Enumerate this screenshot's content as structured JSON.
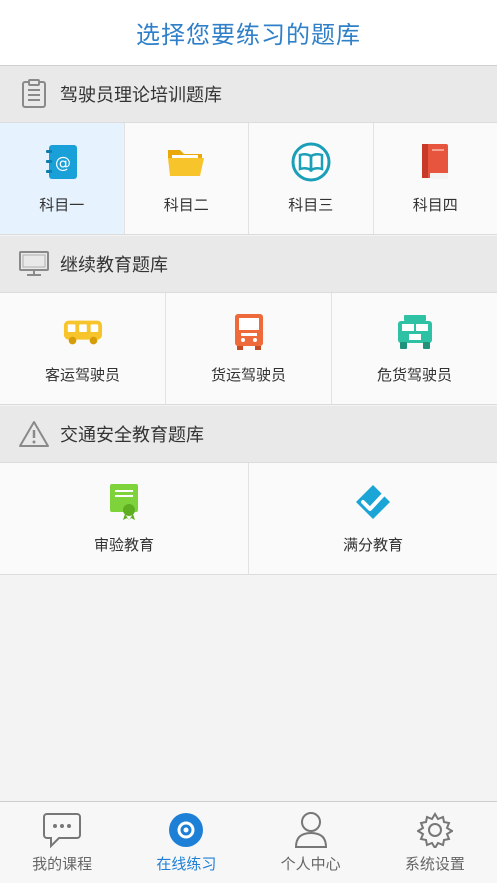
{
  "header": {
    "title": "选择您要练习的题库"
  },
  "colors": {
    "accent": "#1e7fd6",
    "title": "#2f80c8",
    "active_cell": "#e6f2fd"
  },
  "sections": [
    {
      "title": "驾驶员理论培训题库",
      "icon": "clipboard-icon",
      "items": [
        {
          "label": "科目一",
          "icon": "address-book-icon",
          "active": true
        },
        {
          "label": "科目二",
          "icon": "folder-icon"
        },
        {
          "label": "科目三",
          "icon": "book-icon"
        },
        {
          "label": "科目四",
          "icon": "red-book-icon"
        }
      ]
    },
    {
      "title": "继续教育题库",
      "icon": "monitor-icon",
      "items": [
        {
          "label": "客运驾驶员",
          "icon": "bus-icon"
        },
        {
          "label": "货运驾驶员",
          "icon": "truck-front-icon"
        },
        {
          "label": "危货驾驶员",
          "icon": "jeep-icon"
        }
      ]
    },
    {
      "title": "交通安全教育题库",
      "icon": "warning-icon",
      "items": [
        {
          "label": "审验教育",
          "icon": "certificate-icon"
        },
        {
          "label": "满分教育",
          "icon": "checkmark-badge-icon"
        }
      ]
    }
  ],
  "tabbar": [
    {
      "label": "我的课程",
      "icon": "chat-bubble-icon"
    },
    {
      "label": "在线练习",
      "icon": "target-icon",
      "active": true
    },
    {
      "label": "个人中心",
      "icon": "person-icon"
    },
    {
      "label": "系统设置",
      "icon": "gear-icon"
    }
  ]
}
